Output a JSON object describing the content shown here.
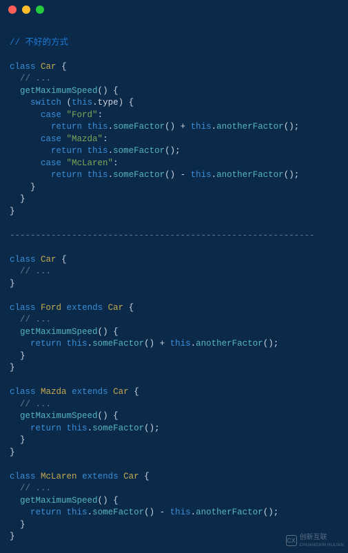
{
  "window": {
    "traffic_lights": [
      "red",
      "yellow",
      "green"
    ]
  },
  "code": {
    "comment_bad": "// 不好的方式",
    "comment_ellipsis": "// ...",
    "kw_class": "class",
    "kw_extends": "extends",
    "kw_switch": "switch",
    "kw_case": "case",
    "kw_return": "return",
    "kw_this": "this",
    "class_Car": "Car",
    "class_Ford": "Ford",
    "class_Mazda": "Mazda",
    "class_McLaren": "McLaren",
    "fn_getMaximumSpeed": "getMaximumSpeed",
    "fn_someFactor": "someFactor",
    "fn_anotherFactor": "anotherFactor",
    "prop_type": "type",
    "str_Ford": "\"Ford\"",
    "str_Mazda": "\"Mazda\"",
    "str_McLaren": "\"McLaren\"",
    "divider": "-----------------------------------------------------------",
    "op_plus": " + ",
    "op_minus": " - ",
    "lbrace": "{",
    "rbrace": "}",
    "lparen": "(",
    "rparen": ")",
    "dot": ".",
    "colon": ":",
    "semicolon": ";"
  },
  "watermark": {
    "icon_text": "CX",
    "main": "创新互联",
    "sub": "CHUANGXIN HULIAN"
  }
}
